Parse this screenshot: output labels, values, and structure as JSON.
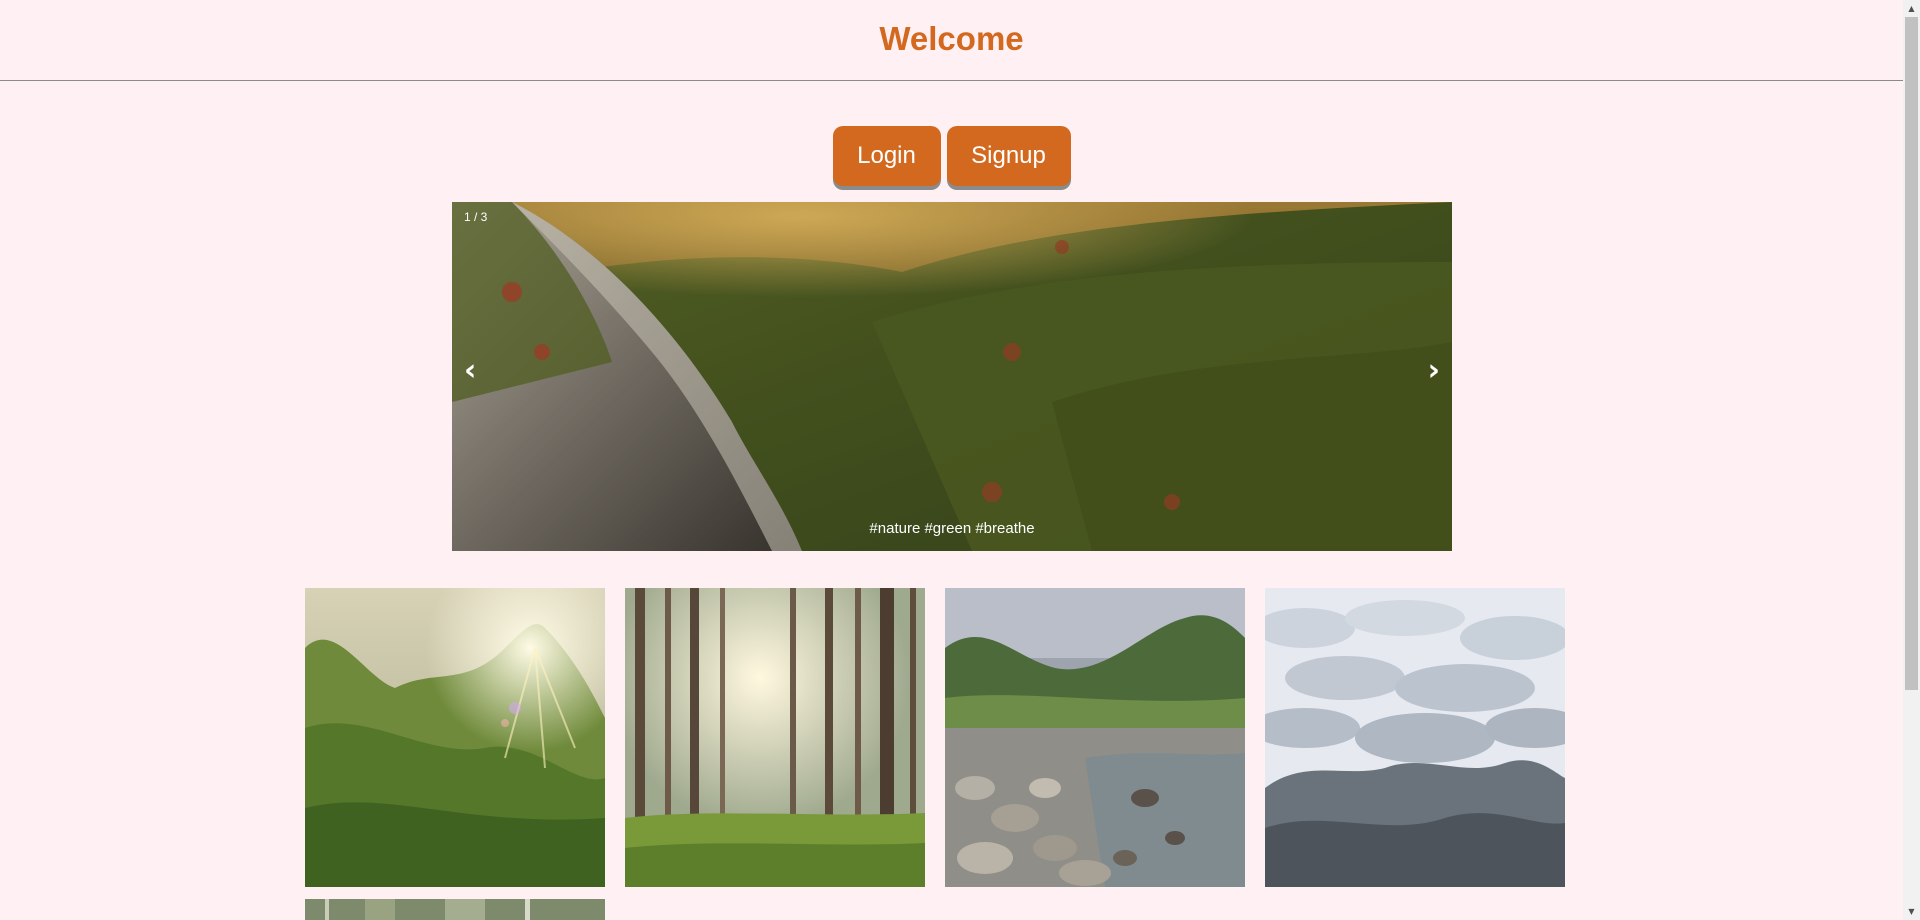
{
  "header": {
    "title": "Welcome"
  },
  "auth": {
    "login_label": "Login",
    "signup_label": "Signup"
  },
  "slideshow": {
    "counter": "1 / 3",
    "prev_symbol": "‹",
    "next_symbol": "›",
    "caption": "#nature #green #breathe"
  },
  "gallery": {
    "items": [
      {
        "name": "sunlit-mountain"
      },
      {
        "name": "forest-sunbeams"
      },
      {
        "name": "rocky-river"
      },
      {
        "name": "misty-hills"
      },
      {
        "name": "forest-partial"
      }
    ]
  },
  "scrollbar": {
    "up_symbol": "▲",
    "down_symbol": "▼"
  },
  "colors": {
    "background": "#fff0f3",
    "accent": "#d2691e",
    "button_text": "#ffffff"
  }
}
